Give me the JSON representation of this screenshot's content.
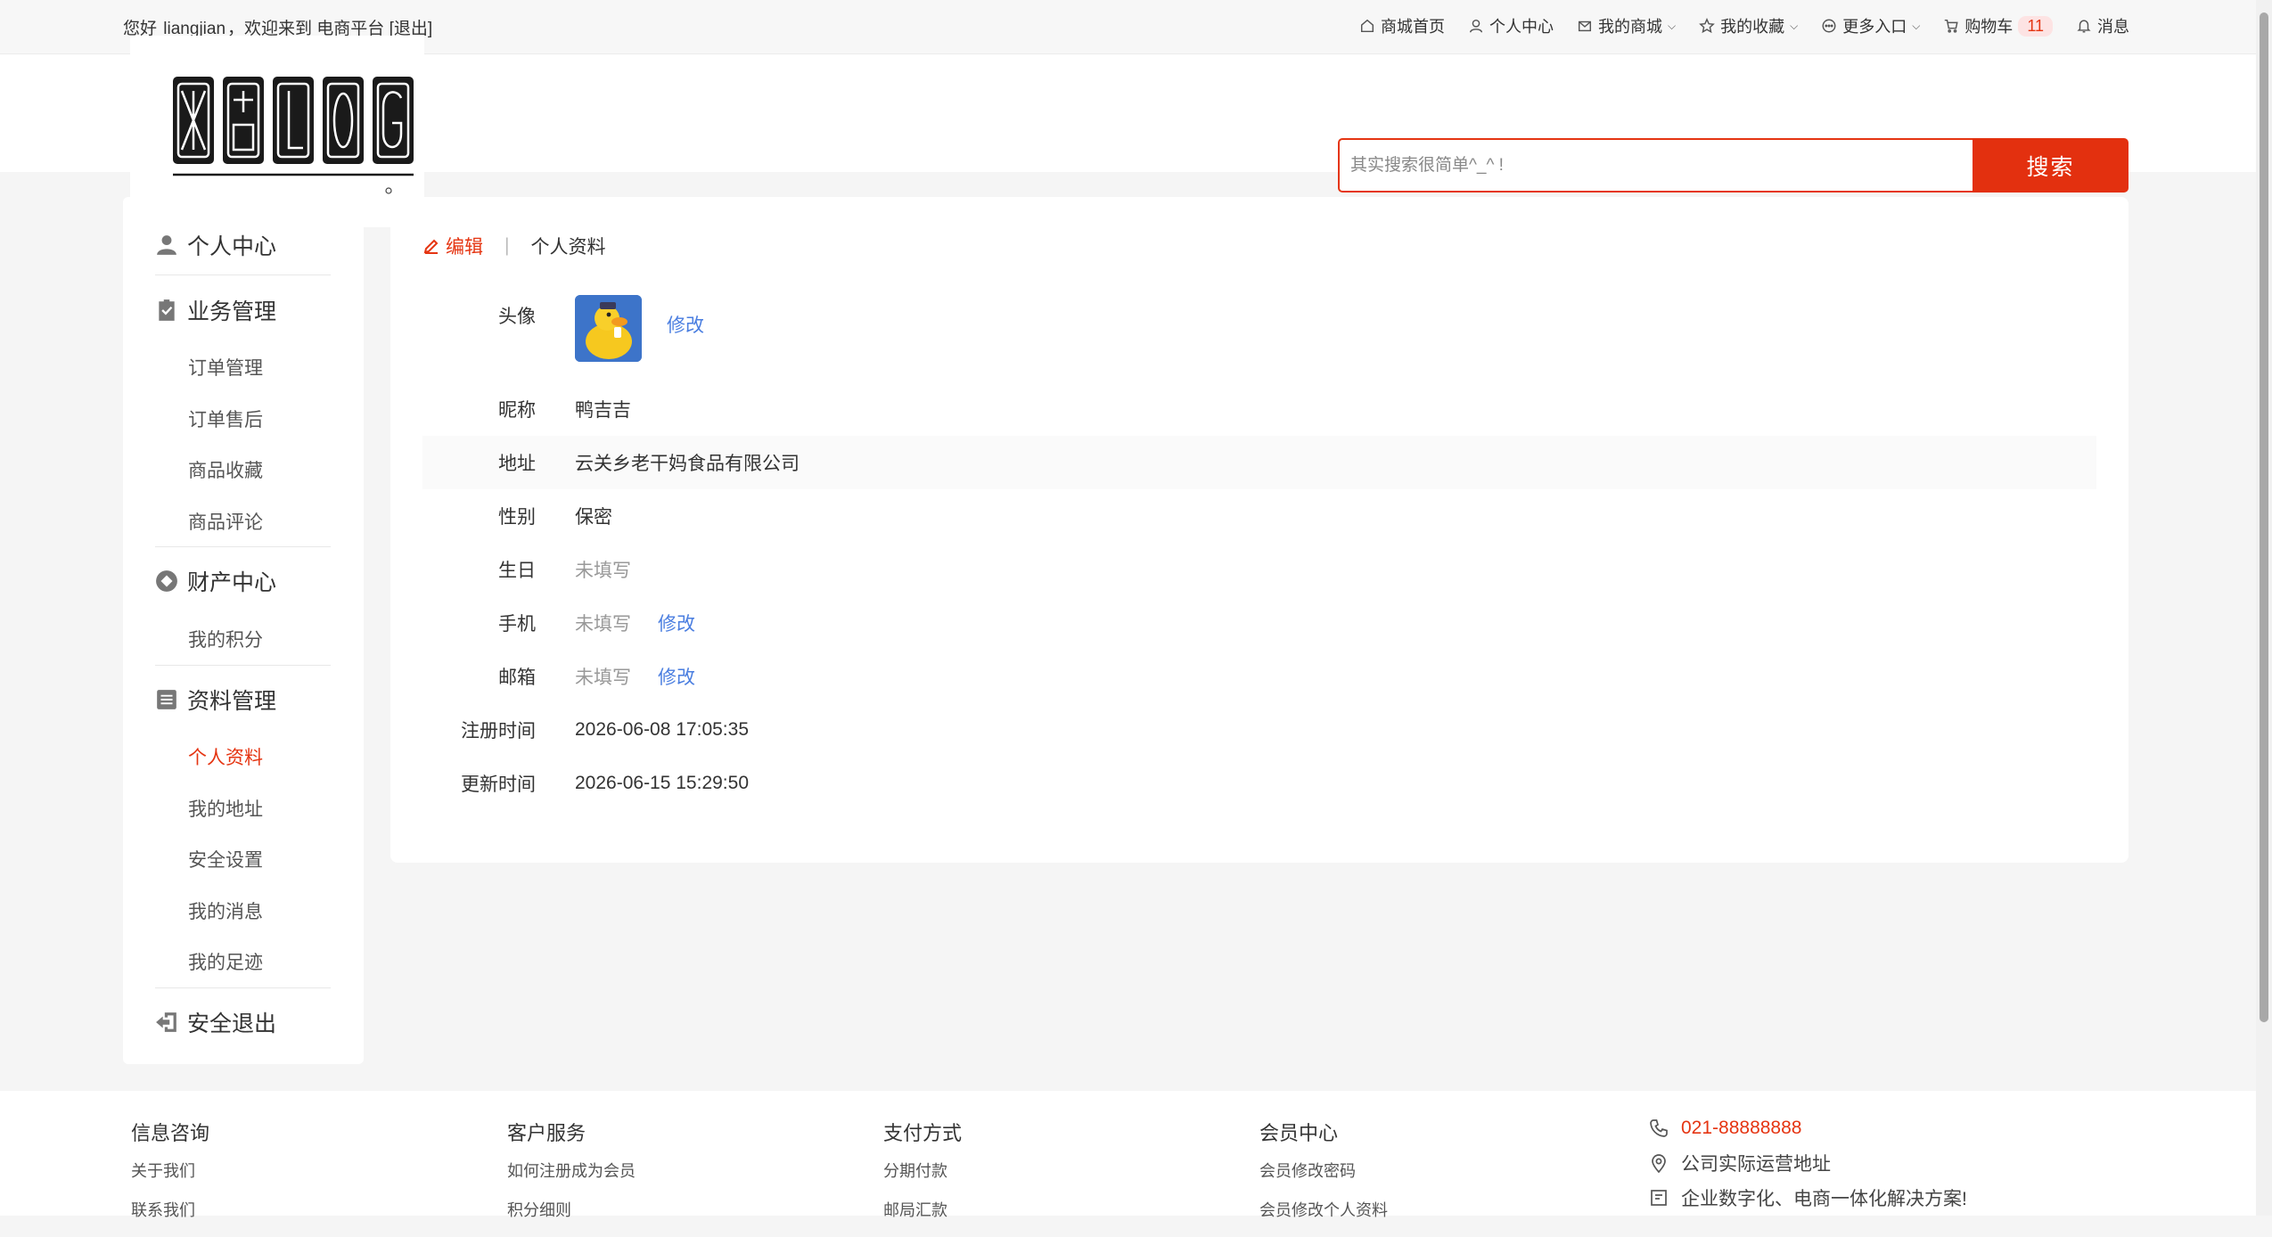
{
  "topbar": {
    "welcome_prefix": "您好",
    "username": "liangjian",
    "welcome_suffix": "，欢迎来到 电商平台",
    "logout": "[退出]",
    "nav": {
      "home": "商城首页",
      "center": "个人中心",
      "myshop": "我的商城",
      "favorites": "我的收藏",
      "more": "更多入口",
      "cart": "购物车",
      "cart_count": "11",
      "messages": "消息"
    }
  },
  "header": {
    "logo_text": "网站LOG",
    "search_placeholder": "其实搜索很简单^_^ !",
    "search_button": "搜索"
  },
  "sidebar": {
    "sections": [
      {
        "title": "个人中心",
        "icon": "user-icon",
        "items": []
      },
      {
        "title": "业务管理",
        "icon": "clipboard-check-icon",
        "items": [
          "订单管理",
          "订单售后",
          "商品收藏",
          "商品评论"
        ]
      },
      {
        "title": "财产中心",
        "icon": "diamond-circle-icon",
        "items": [
          "我的积分"
        ]
      },
      {
        "title": "资料管理",
        "icon": "inbox-icon",
        "items": [
          "个人资料",
          "我的地址",
          "安全设置",
          "我的消息",
          "我的足迹"
        ]
      },
      {
        "title": "安全退出",
        "icon": "exit-icon",
        "items": []
      }
    ],
    "active_item": "个人资料"
  },
  "main": {
    "breadcrumb": {
      "edit": "编辑",
      "current": "个人资料"
    },
    "profile": {
      "avatar": {
        "label": "头像",
        "link": "修改"
      },
      "nickname": {
        "label": "昵称",
        "value": "鸭吉吉"
      },
      "address": {
        "label": "地址",
        "value": "云关乡老干妈食品有限公司"
      },
      "gender": {
        "label": "性别",
        "value": "保密"
      },
      "birthday": {
        "label": "生日",
        "value": "未填写"
      },
      "phone": {
        "label": "手机",
        "value": "未填写",
        "link": "修改"
      },
      "email": {
        "label": "邮箱",
        "value": "未填写",
        "link": "修改"
      },
      "registered": {
        "label": "注册时间",
        "value": "2026-06-08 17:05:35"
      },
      "updated": {
        "label": "更新时间",
        "value": "2026-06-15 15:29:50"
      }
    }
  },
  "footer": {
    "columns": [
      {
        "title": "信息咨询",
        "links": [
          "关于我们",
          "联系我们"
        ]
      },
      {
        "title": "客户服务",
        "links": [
          "如何注册成为会员",
          "积分细则"
        ]
      },
      {
        "title": "支付方式",
        "links": [
          "分期付款",
          "邮局汇款"
        ]
      },
      {
        "title": "会员中心",
        "links": [
          "会员修改密码",
          "会员修改个人资料"
        ]
      }
    ],
    "contact": {
      "phone": "021-88888888",
      "address": "公司实际运营地址",
      "slogan": "企业数字化、电商一体化解决方案!"
    }
  },
  "colors": {
    "accent": "#e53512",
    "link": "#4a7ee0",
    "page_bg": "#f5f5f5"
  }
}
